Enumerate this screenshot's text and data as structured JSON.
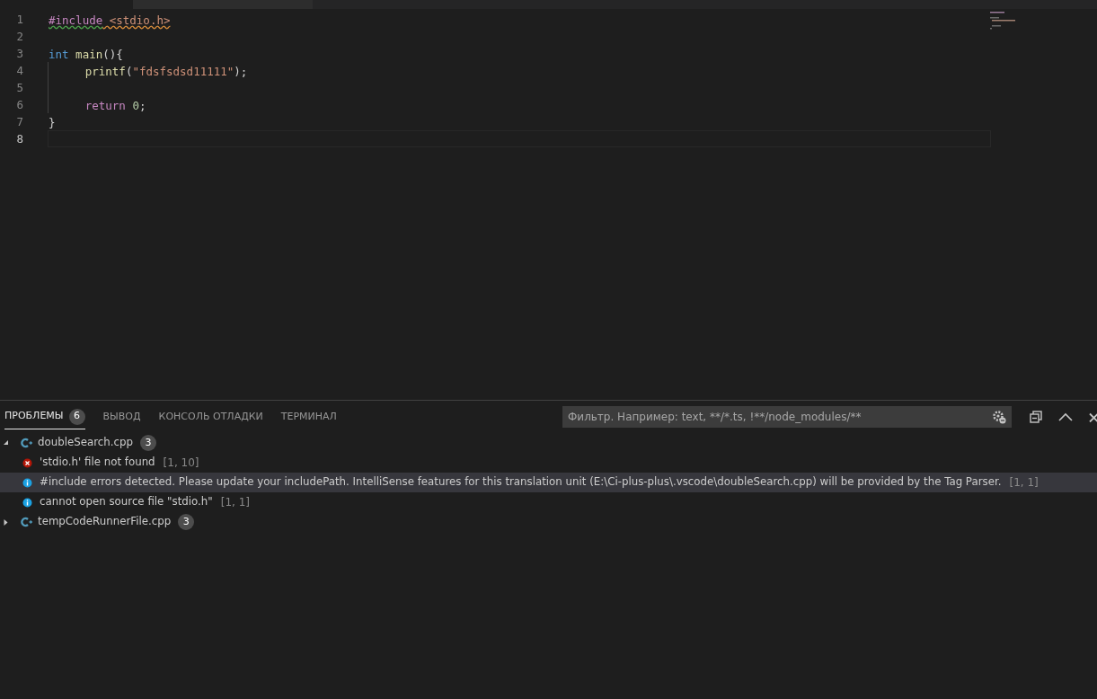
{
  "editor": {
    "lines": [
      {
        "number": "1",
        "current": false,
        "indented": false,
        "tokens": [
          {
            "text": "#include",
            "kind": "directive",
            "warning_squiggle": true
          },
          {
            "text": " <stdio.h>",
            "kind": "string",
            "error_squiggle": true
          }
        ]
      },
      {
        "number": "2",
        "current": false,
        "indented": false
      },
      {
        "number": "3",
        "current": false,
        "indented": false,
        "tokens": [
          {
            "text": "int",
            "kind": "keyword"
          },
          {
            "text": " main",
            "kind": "function"
          },
          {
            "text": "(){",
            "kind": "plain"
          }
        ]
      },
      {
        "number": "4",
        "current": false,
        "indented": true,
        "tokens": [
          {
            "text": "printf",
            "kind": "function"
          },
          {
            "text": "(",
            "kind": "plain"
          },
          {
            "text": "\"fdsfsdsd11111\"",
            "kind": "string"
          },
          {
            "text": ");",
            "kind": "plain"
          }
        ]
      },
      {
        "number": "5",
        "current": false,
        "indented": true
      },
      {
        "number": "6",
        "current": false,
        "indented": true,
        "tokens": [
          {
            "text": "return",
            "kind": "control"
          },
          {
            "text": " 0",
            "kind": "number"
          },
          {
            "text": ";",
            "kind": "plain"
          }
        ]
      },
      {
        "number": "7",
        "current": false,
        "indented": false,
        "tokens": [
          {
            "text": "}",
            "kind": "plain"
          }
        ]
      },
      {
        "number": "8",
        "current": true,
        "indented": false
      }
    ]
  },
  "panel": {
    "tabs": [
      {
        "label": "ПРОБЛЕМЫ",
        "badge": "6",
        "selected": true
      },
      {
        "label": "ВЫВОД",
        "selected": false
      },
      {
        "label": "КОНСОЛЬ ОТЛАДКИ",
        "selected": false
      },
      {
        "label": "ТЕРМИНАЛ",
        "selected": false
      }
    ],
    "filter": {
      "placeholder": "Фильтр. Например: text, **/*.ts, !**/node_modules/**"
    },
    "files": [
      {
        "name": "doubleSearch.cpp",
        "count": "3",
        "expanded": true,
        "children": [
          {
            "kind": "error",
            "text": "'stdio.h' file not found",
            "location": "[1, 10]",
            "selected": false
          },
          {
            "kind": "info",
            "text": "#include errors detected. Please update your includePath. IntelliSense features for this translation unit (E:\\Ci-plus-plus\\.vscode\\doubleSearch.cpp) will be provided by the Tag Parser.",
            "location": "[1, 1]",
            "selected": true
          },
          {
            "kind": "info",
            "text": "cannot open source file \"stdio.h\"",
            "location": "[1, 1]",
            "selected": false
          }
        ]
      },
      {
        "name": "tempCodeRunnerFile.cpp",
        "count": "3",
        "expanded": false
      }
    ]
  }
}
